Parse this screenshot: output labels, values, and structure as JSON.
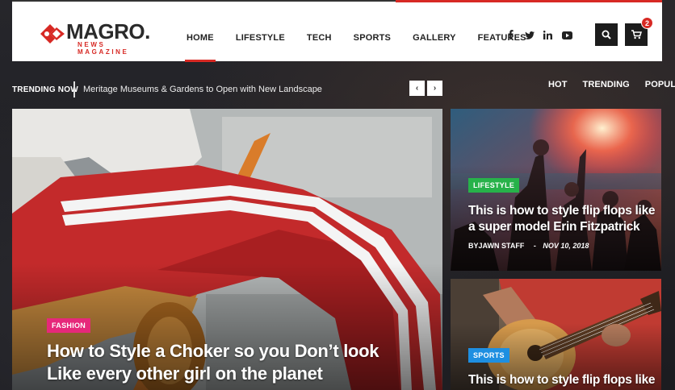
{
  "brand": {
    "name": "MAGRO.",
    "tagline": "NEWS MAGAZINE",
    "accent": "#d72924"
  },
  "nav": {
    "items": [
      "HOME",
      "LIFESTYLE",
      "TECH",
      "SPORTS",
      "GALLERY",
      "FEATURES"
    ],
    "active": "HOME"
  },
  "social": [
    "facebook-icon",
    "twitter-icon",
    "linkedin-icon",
    "youtube-icon"
  ],
  "header_actions": {
    "search_icon": "search-icon",
    "cart_icon": "cart-icon",
    "cart_count": "2"
  },
  "trending": {
    "label": "TRENDING NOW",
    "headline": "Meritage Museums & Gardens to Open with New Landscape",
    "prev": "‹",
    "next": "›"
  },
  "filter_tabs": [
    "HOT",
    "TRENDING",
    "POPULAR"
  ],
  "featured": {
    "main": {
      "category": "FASHION",
      "category_color": "#e6287a",
      "title_line1": "How to Style a Choker so you Don’t look",
      "title_line2": "Like every other girl on the planet"
    },
    "side1": {
      "category": "LIFESTYLE",
      "category_color": "#27b24a",
      "title_line1": "This is how to style flip flops like",
      "title_line2": "a super model Erin Fitzpatrick",
      "author": "BYJAWN STAFF",
      "separator": "-",
      "date": "NOV 10, 2018"
    },
    "side2": {
      "category": "SPORTS",
      "category_color": "#1e8fe1",
      "title_line1": "This is how to style flip flops like"
    }
  }
}
